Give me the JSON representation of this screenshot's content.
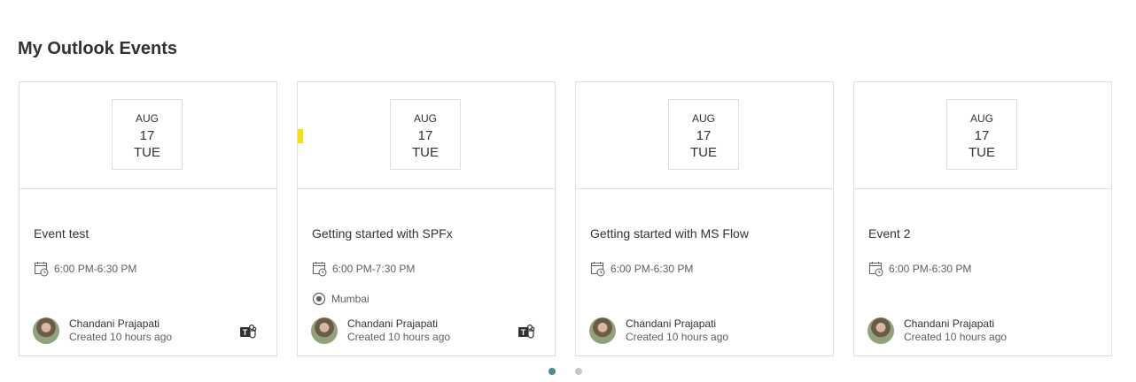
{
  "webpart": {
    "title": "My Outlook Events"
  },
  "events": [
    {
      "month": "AUG",
      "day": "17",
      "weekday": "TUE",
      "title": "Event test",
      "time": "6:00 PM-6:30 PM",
      "location": "",
      "author": "Chandani Prajapati",
      "created": "Created 10 hours ago",
      "teams_icon": "teams-icon"
    },
    {
      "month": "AUG",
      "day": "17",
      "weekday": "TUE",
      "title": "Getting started with SPFx",
      "time": "6:00 PM-7:30 PM",
      "location": "Mumbai",
      "author": "Chandani Prajapati",
      "created": "Created 10 hours ago",
      "teams_icon": "teams-icon"
    },
    {
      "month": "AUG",
      "day": "17",
      "weekday": "TUE",
      "title": "Getting started with MS Flow",
      "time": "6:00 PM-6:30 PM",
      "location": "",
      "author": "Chandani Prajapati",
      "created": "Created 10 hours ago",
      "teams_icon": ""
    },
    {
      "month": "AUG",
      "day": "17",
      "weekday": "TUE",
      "title": "Event 2",
      "time": "6:00 PM-6:30 PM",
      "location": "",
      "author": "Chandani Prajapati",
      "created": "Created 10 hours ago",
      "teams_icon": ""
    }
  ],
  "pager": {
    "active_index": 0,
    "pages": 2
  },
  "colors": {
    "accent": "#4a8c8c",
    "highlight": "#f4e600",
    "border": "#e1dfdd"
  }
}
